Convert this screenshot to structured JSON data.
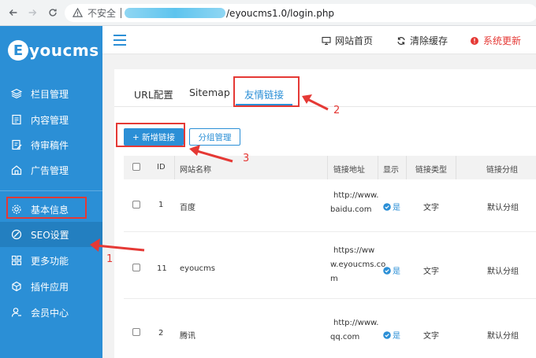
{
  "browser": {
    "insecure_label": "不安全",
    "url_suffix": "/eyoucms1.0/login.php"
  },
  "logo": {
    "mark": "E",
    "text": "youcms"
  },
  "sidebar": {
    "items": [
      {
        "label": "栏目管理",
        "icon": "layers-icon"
      },
      {
        "label": "内容管理",
        "icon": "document-icon"
      },
      {
        "label": "待审稿件",
        "icon": "edit-doc-icon"
      },
      {
        "label": "广告管理",
        "icon": "home-ad-icon"
      },
      {
        "label": "基本信息",
        "icon": "gear-icon"
      },
      {
        "label": "SEO设置",
        "icon": "seo-icon"
      },
      {
        "label": "更多功能",
        "icon": "grid-icon"
      },
      {
        "label": "插件应用",
        "icon": "cube-icon"
      },
      {
        "label": "会员中心",
        "icon": "user-icon"
      }
    ]
  },
  "topbar": {
    "home_label": "网站首页",
    "cache_label": "清除缓存",
    "update_label": "系统更新"
  },
  "tabs": [
    {
      "label": "URL配置"
    },
    {
      "label": "Sitemap"
    },
    {
      "label": "友情链接"
    }
  ],
  "buttons": {
    "add_label": "+ 新增链接",
    "group_label": "分组管理"
  },
  "table": {
    "headers": [
      "ID",
      "网站名称",
      "链接地址",
      "显示",
      "链接类型",
      "链接分组"
    ],
    "rows": [
      {
        "id": "1",
        "name": "百度",
        "url_lines": [
          "http://www.",
          "baidu.com"
        ],
        "show": "是",
        "type": "文字",
        "group": "默认分组"
      },
      {
        "id": "11",
        "name": "eyoucms",
        "url_lines": [
          "https://ww",
          "w.eyoucms.co",
          "m"
        ],
        "show": "是",
        "type": "文字",
        "group": "默认分组"
      },
      {
        "id": "2",
        "name": "腾讯",
        "url_lines": [
          "http://www.",
          "qq.com"
        ],
        "show": "是",
        "type": "文字",
        "group": "默认分组"
      }
    ]
  },
  "annotations": {
    "a1": "1",
    "a2": "2",
    "a3": "3"
  },
  "colors": {
    "accent": "#2b8fd6",
    "annotation": "#e53935"
  }
}
